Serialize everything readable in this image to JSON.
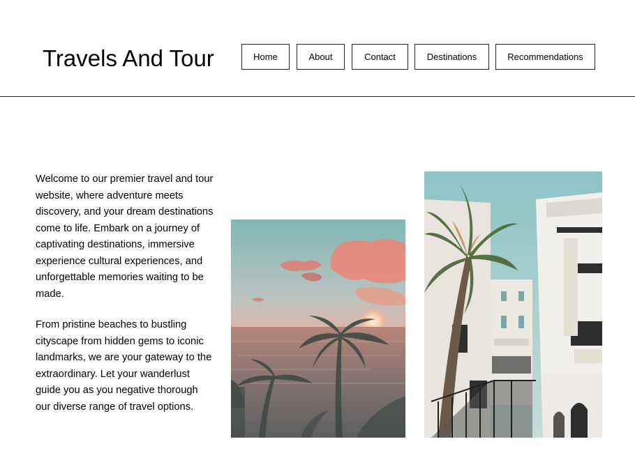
{
  "header": {
    "title": "Travels And Tour",
    "nav": [
      {
        "label": "Home"
      },
      {
        "label": "About"
      },
      {
        "label": "Contact"
      },
      {
        "label": "Destinations"
      },
      {
        "label": "Recommendations"
      }
    ]
  },
  "main": {
    "paragraphs": [
      "Welcome to our premier travel and tour website, where adventure meets discovery, and your dream destinations come to life. Embark on a journey of captivating destinations, immersive experience cultural experiences, and unforgettable memories waiting to be made.",
      "From pristine beaches to bustling cityscape from hidden gems to iconic landmarks, we are your gateway to the extraordinary. Let your wanderlust guide you as you negative thorough our diverse range of travel options."
    ]
  },
  "colors": {
    "border": "#222222",
    "background": "#ffffff"
  }
}
